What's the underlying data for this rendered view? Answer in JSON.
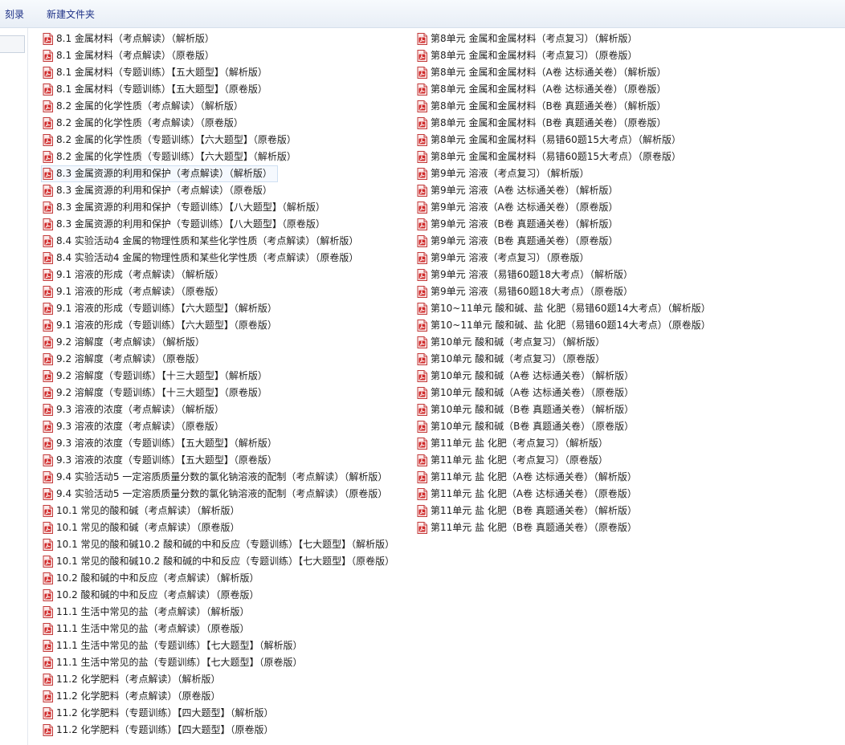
{
  "toolbar": {
    "burn_label": "刻录",
    "new_folder_label": "新建文件夹"
  },
  "colors": {
    "pdf_icon": "#d02a2a",
    "toolbar_text": "#1e3287",
    "selection": "#cfe0f2"
  },
  "files": {
    "column1": [
      "8.1 金属材料（考点解读）（解析版）",
      "8.1 金属材料（考点解读）（原卷版）",
      "8.1 金属材料（专题训练）【五大题型】（解析版）",
      "8.1 金属材料（专题训练）【五大题型】（原卷版）",
      "8.2 金属的化学性质（考点解读）（解析版）",
      "8.2 金属的化学性质（考点解读）（原卷版）",
      "8.2 金属的化学性质（专题训练）【六大题型】（原卷版）",
      "8.2 金属的化学性质（专题训练）【六大题型】（解析版）",
      "8.3 金属资源的利用和保护（考点解读）（解析版）",
      "8.3 金属资源的利用和保护（考点解读）（原卷版）",
      "8.3 金属资源的利用和保护（专题训练）【八大题型】（解析版）",
      "8.3 金属资源的利用和保护（专题训练）【八大题型】（原卷版）",
      "8.4 实验活动4 金属的物理性质和某些化学性质（考点解读）（解析版）",
      "8.4 实验活动4 金属的物理性质和某些化学性质（考点解读）（原卷版）",
      "9.1 溶液的形成（考点解读）（解析版）",
      "9.1 溶液的形成（考点解读）（原卷版）",
      "9.1 溶液的形成（专题训练）【六大题型】（解析版）",
      "9.1 溶液的形成（专题训练）【六大题型】（原卷版）",
      "9.2 溶解度（考点解读）（解析版）",
      "9.2 溶解度（考点解读）（原卷版）",
      "9.2 溶解度（专题训练）【十三大题型】（解析版）",
      "9.2 溶解度（专题训练）【十三大题型】（原卷版）",
      "9.3 溶液的浓度（考点解读）（解析版）",
      "9.3 溶液的浓度（考点解读）（原卷版）",
      "9.3 溶液的浓度（专题训练）【五大题型】（解析版）",
      "9.3 溶液的浓度（专题训练）【五大题型】（原卷版）",
      "9.4 实验活动5 一定溶质质量分数的氯化钠溶液的配制（考点解读）（解析版）",
      "9.4 实验活动5 一定溶质质量分数的氯化钠溶液的配制（考点解读）（原卷版）",
      "10.1 常见的酸和碱（考点解读）（解析版）",
      "10.1 常见的酸和碱（考点解读）（原卷版）",
      "10.1 常见的酸和碱10.2 酸和碱的中和反应（专题训练）【七大题型】（解析版）",
      "10.1 常见的酸和碱10.2 酸和碱的中和反应（专题训练）【七大题型】（原卷版）",
      "10.2 酸和碱的中和反应（考点解读）（解析版）",
      "10.2 酸和碱的中和反应（考点解读）（原卷版）",
      "11.1 生活中常见的盐（考点解读）（解析版）",
      "11.1 生活中常见的盐（考点解读）（原卷版）",
      "11.1 生活中常见的盐（专题训练）【七大题型】（解析版）",
      "11.1 生活中常见的盐（专题训练）【七大题型】（原卷版）",
      "11.2 化学肥料（考点解读）（解析版）",
      "11.2 化学肥料（考点解读）（原卷版）",
      "11.2 化学肥料（专题训练）【四大题型】（解析版）",
      "11.2 化学肥料（专题训练）【四大题型】（原卷版）"
    ],
    "column2": [
      "第8单元  金属和金属材料（考点复习）（解析版）",
      "第8单元  金属和金属材料（考点复习）（原卷版）",
      "第8单元 金属和金属材料（A卷 达标通关卷）（解析版）",
      "第8单元 金属和金属材料（A卷 达标通关卷）（原卷版）",
      "第8单元 金属和金属材料（B卷 真题通关卷）（解析版）",
      "第8单元 金属和金属材料（B卷 真题通关卷）（原卷版）",
      "第8单元 金属和金属材料（易错60题15大考点）（解析版）",
      "第8单元 金属和金属材料（易错60题15大考点）（原卷版）",
      "第9单元  溶液（考点复习）（解析版）",
      "第9单元 溶液（A卷 达标通关卷）（解析版）",
      "第9单元 溶液（A卷 达标通关卷）（原卷版）",
      "第9单元 溶液（B卷 真题通关卷）（解析版）",
      "第9单元 溶液（B卷 真题通关卷）（原卷版）",
      "第9单元 溶液（考点复习）（原卷版）",
      "第9单元 溶液（易错60题18大考点）（解析版）",
      "第9单元 溶液（易错60题18大考点）（原卷版）",
      "第10~11单元 酸和碱、盐 化肥（易错60题14大考点）（解析版）",
      "第10~11单元 酸和碱、盐 化肥（易错60题14大考点）（原卷版）",
      "第10单元  酸和碱（考点复习）（解析版）",
      "第10单元  酸和碱（考点复习）（原卷版）",
      "第10单元 酸和碱（A卷 达标通关卷）（解析版）",
      "第10单元 酸和碱（A卷 达标通关卷）（原卷版）",
      "第10单元 酸和碱（B卷 真题通关卷）（解析版）",
      "第10单元 酸和碱（B卷 真题通关卷）（原卷版）",
      "第11单元  盐 化肥（考点复习）（解析版）",
      "第11单元  盐 化肥（考点复习）（原卷版）",
      "第11单元 盐 化肥（A卷 达标通关卷）（解析版）",
      "第11单元 盐 化肥（A卷 达标通关卷）（原卷版）",
      "第11单元 盐 化肥（B卷 真题通关卷）（解析版）",
      "第11单元 盐 化肥（B卷 真题通关卷）（原卷版）"
    ]
  }
}
